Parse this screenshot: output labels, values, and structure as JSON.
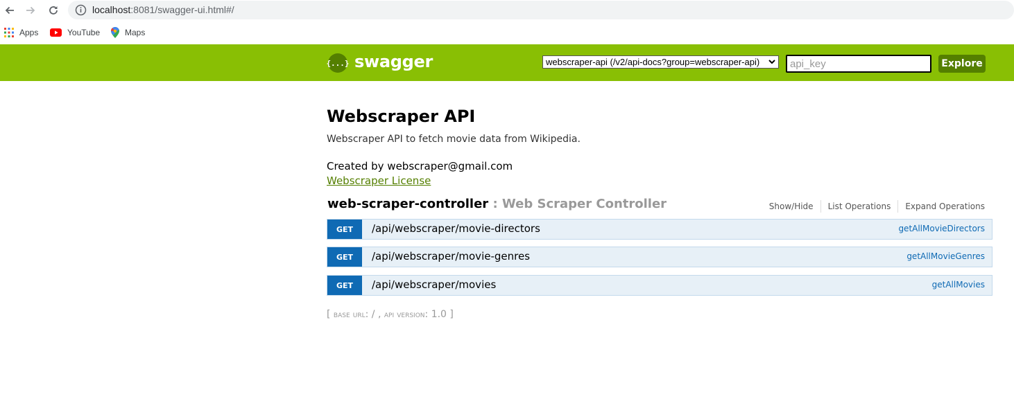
{
  "browser": {
    "url_host": "localhost",
    "url_rest": ":8081/swagger-ui.html#/",
    "bookmarks": [
      {
        "label": "Apps"
      },
      {
        "label": "YouTube"
      },
      {
        "label": "Maps"
      }
    ]
  },
  "header": {
    "logo_text": "swagger",
    "logo_glyph": "{...}",
    "api_select_value": "webscraper-api (/v2/api-docs?group=webscraper-api)",
    "api_key_placeholder": "api_key",
    "explore_label": "Explore",
    "brand_color": "#89bf04",
    "brand_dark_color": "#547f00"
  },
  "info": {
    "title": "Webscraper API",
    "description": "Webscraper API to fetch movie data from Wikipedia.",
    "created_by": "Created by webscraper@gmail.com",
    "license_link": "Webscraper License"
  },
  "controller": {
    "name": "web-scraper-controller",
    "description": " : Web Scraper Controller",
    "actions": [
      "Show/Hide",
      "List Operations",
      "Expand Operations"
    ]
  },
  "operations": [
    {
      "method": "GET",
      "path": "/api/webscraper/movie-directors",
      "nickname": "getAllMovieDirectors"
    },
    {
      "method": "GET",
      "path": "/api/webscraper/movie-genres",
      "nickname": "getAllMovieGenres"
    },
    {
      "method": "GET",
      "path": "/api/webscraper/movies",
      "nickname": "getAllMovies"
    }
  ],
  "footer": {
    "open_bracket": "[ ",
    "base_url_label": "base url",
    "base_url_value": ": / , ",
    "api_version_label": "api version",
    "api_version_value": ": 1.0 ",
    "close_bracket": "]"
  }
}
